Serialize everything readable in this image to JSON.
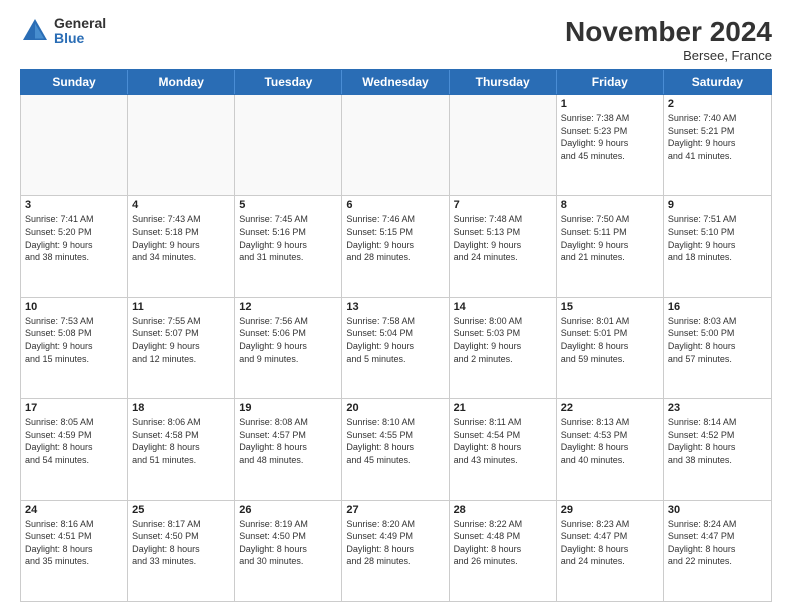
{
  "logo": {
    "general": "General",
    "blue": "Blue"
  },
  "header": {
    "title": "November 2024",
    "location": "Bersee, France"
  },
  "weekdays": [
    "Sunday",
    "Monday",
    "Tuesday",
    "Wednesday",
    "Thursday",
    "Friday",
    "Saturday"
  ],
  "rows": [
    [
      {
        "day": "",
        "info": "",
        "empty": true
      },
      {
        "day": "",
        "info": "",
        "empty": true
      },
      {
        "day": "",
        "info": "",
        "empty": true
      },
      {
        "day": "",
        "info": "",
        "empty": true
      },
      {
        "day": "",
        "info": "",
        "empty": true
      },
      {
        "day": "1",
        "info": "Sunrise: 7:38 AM\nSunset: 5:23 PM\nDaylight: 9 hours\nand 45 minutes.",
        "empty": false
      },
      {
        "day": "2",
        "info": "Sunrise: 7:40 AM\nSunset: 5:21 PM\nDaylight: 9 hours\nand 41 minutes.",
        "empty": false
      }
    ],
    [
      {
        "day": "3",
        "info": "Sunrise: 7:41 AM\nSunset: 5:20 PM\nDaylight: 9 hours\nand 38 minutes.",
        "empty": false
      },
      {
        "day": "4",
        "info": "Sunrise: 7:43 AM\nSunset: 5:18 PM\nDaylight: 9 hours\nand 34 minutes.",
        "empty": false
      },
      {
        "day": "5",
        "info": "Sunrise: 7:45 AM\nSunset: 5:16 PM\nDaylight: 9 hours\nand 31 minutes.",
        "empty": false
      },
      {
        "day": "6",
        "info": "Sunrise: 7:46 AM\nSunset: 5:15 PM\nDaylight: 9 hours\nand 28 minutes.",
        "empty": false
      },
      {
        "day": "7",
        "info": "Sunrise: 7:48 AM\nSunset: 5:13 PM\nDaylight: 9 hours\nand 24 minutes.",
        "empty": false
      },
      {
        "day": "8",
        "info": "Sunrise: 7:50 AM\nSunset: 5:11 PM\nDaylight: 9 hours\nand 21 minutes.",
        "empty": false
      },
      {
        "day": "9",
        "info": "Sunrise: 7:51 AM\nSunset: 5:10 PM\nDaylight: 9 hours\nand 18 minutes.",
        "empty": false
      }
    ],
    [
      {
        "day": "10",
        "info": "Sunrise: 7:53 AM\nSunset: 5:08 PM\nDaylight: 9 hours\nand 15 minutes.",
        "empty": false
      },
      {
        "day": "11",
        "info": "Sunrise: 7:55 AM\nSunset: 5:07 PM\nDaylight: 9 hours\nand 12 minutes.",
        "empty": false
      },
      {
        "day": "12",
        "info": "Sunrise: 7:56 AM\nSunset: 5:06 PM\nDaylight: 9 hours\nand 9 minutes.",
        "empty": false
      },
      {
        "day": "13",
        "info": "Sunrise: 7:58 AM\nSunset: 5:04 PM\nDaylight: 9 hours\nand 5 minutes.",
        "empty": false
      },
      {
        "day": "14",
        "info": "Sunrise: 8:00 AM\nSunset: 5:03 PM\nDaylight: 9 hours\nand 2 minutes.",
        "empty": false
      },
      {
        "day": "15",
        "info": "Sunrise: 8:01 AM\nSunset: 5:01 PM\nDaylight: 8 hours\nand 59 minutes.",
        "empty": false
      },
      {
        "day": "16",
        "info": "Sunrise: 8:03 AM\nSunset: 5:00 PM\nDaylight: 8 hours\nand 57 minutes.",
        "empty": false
      }
    ],
    [
      {
        "day": "17",
        "info": "Sunrise: 8:05 AM\nSunset: 4:59 PM\nDaylight: 8 hours\nand 54 minutes.",
        "empty": false
      },
      {
        "day": "18",
        "info": "Sunrise: 8:06 AM\nSunset: 4:58 PM\nDaylight: 8 hours\nand 51 minutes.",
        "empty": false
      },
      {
        "day": "19",
        "info": "Sunrise: 8:08 AM\nSunset: 4:57 PM\nDaylight: 8 hours\nand 48 minutes.",
        "empty": false
      },
      {
        "day": "20",
        "info": "Sunrise: 8:10 AM\nSunset: 4:55 PM\nDaylight: 8 hours\nand 45 minutes.",
        "empty": false
      },
      {
        "day": "21",
        "info": "Sunrise: 8:11 AM\nSunset: 4:54 PM\nDaylight: 8 hours\nand 43 minutes.",
        "empty": false
      },
      {
        "day": "22",
        "info": "Sunrise: 8:13 AM\nSunset: 4:53 PM\nDaylight: 8 hours\nand 40 minutes.",
        "empty": false
      },
      {
        "day": "23",
        "info": "Sunrise: 8:14 AM\nSunset: 4:52 PM\nDaylight: 8 hours\nand 38 minutes.",
        "empty": false
      }
    ],
    [
      {
        "day": "24",
        "info": "Sunrise: 8:16 AM\nSunset: 4:51 PM\nDaylight: 8 hours\nand 35 minutes.",
        "empty": false
      },
      {
        "day": "25",
        "info": "Sunrise: 8:17 AM\nSunset: 4:50 PM\nDaylight: 8 hours\nand 33 minutes.",
        "empty": false
      },
      {
        "day": "26",
        "info": "Sunrise: 8:19 AM\nSunset: 4:50 PM\nDaylight: 8 hours\nand 30 minutes.",
        "empty": false
      },
      {
        "day": "27",
        "info": "Sunrise: 8:20 AM\nSunset: 4:49 PM\nDaylight: 8 hours\nand 28 minutes.",
        "empty": false
      },
      {
        "day": "28",
        "info": "Sunrise: 8:22 AM\nSunset: 4:48 PM\nDaylight: 8 hours\nand 26 minutes.",
        "empty": false
      },
      {
        "day": "29",
        "info": "Sunrise: 8:23 AM\nSunset: 4:47 PM\nDaylight: 8 hours\nand 24 minutes.",
        "empty": false
      },
      {
        "day": "30",
        "info": "Sunrise: 8:24 AM\nSunset: 4:47 PM\nDaylight: 8 hours\nand 22 minutes.",
        "empty": false
      }
    ]
  ]
}
